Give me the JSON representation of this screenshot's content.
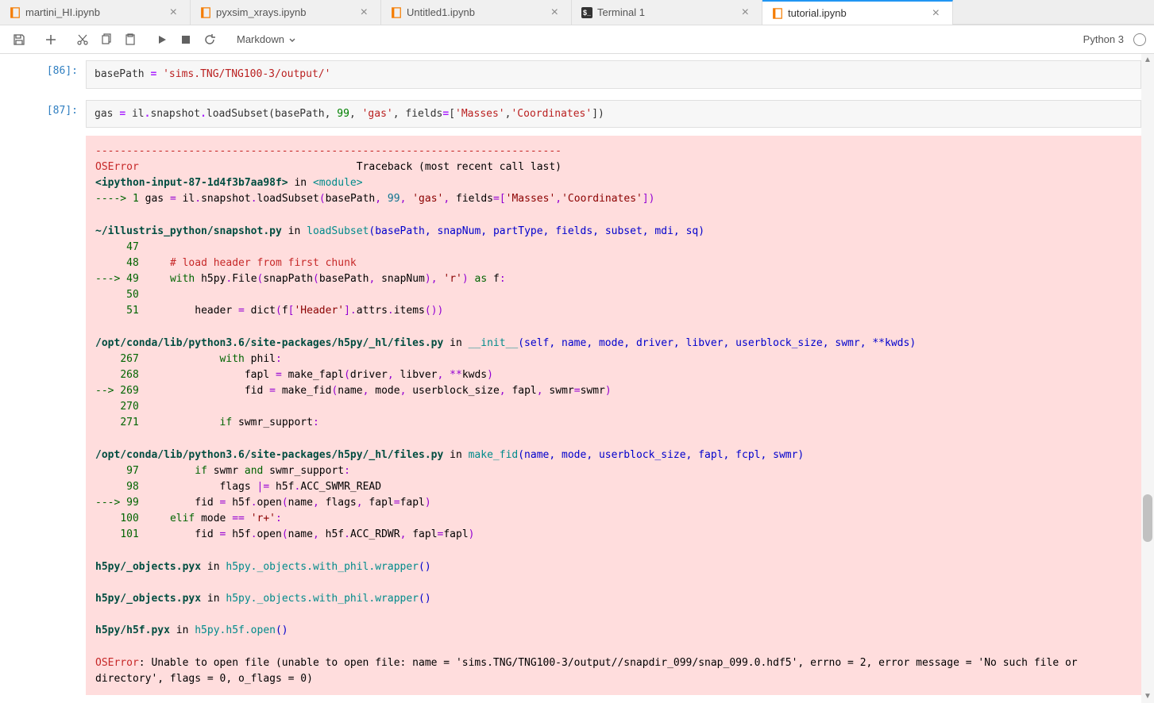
{
  "tabs": [
    {
      "label": "martini_HI.ipynb",
      "type": "notebook",
      "active": false
    },
    {
      "label": "pyxsim_xrays.ipynb",
      "type": "notebook",
      "active": false
    },
    {
      "label": "Untitled1.ipynb",
      "type": "notebook",
      "active": false
    },
    {
      "label": "Terminal 1",
      "type": "terminal",
      "active": false
    },
    {
      "label": "tutorial.ipynb",
      "type": "notebook",
      "active": true
    }
  ],
  "toolbar": {
    "save_title": "Save",
    "add_title": "Insert cell",
    "cut_title": "Cut",
    "copy_title": "Copy",
    "paste_title": "Paste",
    "run_title": "Run",
    "stop_title": "Interrupt",
    "restart_title": "Restart",
    "cell_type": "Markdown"
  },
  "kernel": {
    "name": "Python 3",
    "status": "idle"
  },
  "cells": [
    {
      "prompt": "[86]:",
      "type": "code",
      "source_html": "basePath <span class='s-op'>=</span> <span class='s-str'>'sims.TNG/TNG100-3/output/'</span>"
    },
    {
      "prompt": "[87]:",
      "type": "code",
      "source_html": "gas <span class='s-op'>=</span> il<span class='s-op'>.</span>snapshot<span class='s-op'>.</span>loadSubset(basePath, <span class='s-num'>99</span>, <span class='s-str'>'gas'</span>, fields<span class='s-op'>=</span>[<span class='s-str'>'Masses'</span>,<span class='s-str'>'Coordinates'</span>])"
    }
  ],
  "traceback_lines": [
    {
      "html": "<span class='tb-red'>---------------------------------------------------------------------------</span>"
    },
    {
      "html": "<span class='tb-red'>OSError</span>                                   Traceback (most recent call last)"
    },
    {
      "html": "<span class='tb-darkgreen'>&lt;ipython-input-87-1d4f3b7aa98f&gt;</span> in <span class='tb-cyan'>&lt;module&gt;</span>"
    },
    {
      "html": "<span class='tb-green'>----&gt; 1</span> gas <span class='tb-purple'>=</span> il<span class='tb-purple'>.</span>snapshot<span class='tb-purple'>.</span>loadSubset<span class='tb-purple'>(</span>basePath<span class='tb-purple'>,</span> <span class='tb-cyan-b'>99</span><span class='tb-purple'>,</span> <span class='tb-darkred'>'gas'</span><span class='tb-purple'>,</span> fields<span class='tb-purple'>=[</span><span class='tb-darkred'>'Masses'</span><span class='tb-purple'>,</span><span class='tb-darkred'>'Coordinates'</span><span class='tb-purple'>])</span>"
    },
    {
      "html": ""
    },
    {
      "html": "<span class='tb-darkgreen'>~/illustris_python/snapshot.py</span> in <span class='tb-cyan'>loadSubset</span><span class='tb-blue'>(basePath, snapNum, partType, fields, subset, mdi, sq)</span>"
    },
    {
      "html": "<span class='tb-green'>     47</span> "
    },
    {
      "html": "<span class='tb-green'>     48</span>     <span class='tb-red'># load header from first chunk</span>"
    },
    {
      "html": "<span class='tb-green'>---&gt; 49</span>     <span class='tb-green'>with</span> h5py<span class='tb-purple'>.</span>File<span class='tb-purple'>(</span>snapPath<span class='tb-purple'>(</span>basePath<span class='tb-purple'>,</span> snapNum<span class='tb-purple'>),</span> <span class='tb-darkred'>'r'</span><span class='tb-purple'>)</span> <span class='tb-green'>as</span> f<span class='tb-purple'>:</span>"
    },
    {
      "html": "<span class='tb-green'>     50</span> "
    },
    {
      "html": "<span class='tb-green'>     51</span>         header <span class='tb-purple'>=</span> dict<span class='tb-purple'>(</span>f<span class='tb-purple'>[</span><span class='tb-darkred'>'Header'</span><span class='tb-purple'>].</span>attrs<span class='tb-purple'>.</span>items<span class='tb-purple'>())</span>"
    },
    {
      "html": ""
    },
    {
      "html": "<span class='tb-darkgreen'>/opt/conda/lib/python3.6/site-packages/h5py/_hl/files.py</span> in <span class='tb-cyan'>__init__</span><span class='tb-blue'>(self, name, mode, driver, libver, userblock_size, swmr, **kwds)</span>"
    },
    {
      "html": "<span class='tb-green'>    267</span>             <span class='tb-green'>with</span> phil<span class='tb-purple'>:</span>"
    },
    {
      "html": "<span class='tb-green'>    268</span>                 fapl <span class='tb-purple'>=</span> make_fapl<span class='tb-purple'>(</span>driver<span class='tb-purple'>,</span> libver<span class='tb-purple'>,</span> <span class='tb-purple'>**</span>kwds<span class='tb-purple'>)</span>"
    },
    {
      "html": "<span class='tb-green'>--&gt; 269</span>                 fid <span class='tb-purple'>=</span> make_fid<span class='tb-purple'>(</span>name<span class='tb-purple'>,</span> mode<span class='tb-purple'>,</span> userblock_size<span class='tb-purple'>,</span> fapl<span class='tb-purple'>,</span> swmr<span class='tb-purple'>=</span>swmr<span class='tb-purple'>)</span>"
    },
    {
      "html": "<span class='tb-green'>    270</span> "
    },
    {
      "html": "<span class='tb-green'>    271</span>             <span class='tb-green'>if</span> swmr_support<span class='tb-purple'>:</span>"
    },
    {
      "html": ""
    },
    {
      "html": "<span class='tb-darkgreen'>/opt/conda/lib/python3.6/site-packages/h5py/_hl/files.py</span> in <span class='tb-cyan'>make_fid</span><span class='tb-blue'>(name, mode, userblock_size, fapl, fcpl, swmr)</span>"
    },
    {
      "html": "<span class='tb-green'>     97</span>         <span class='tb-green'>if</span> swmr <span class='tb-green'>and</span> swmr_support<span class='tb-purple'>:</span>"
    },
    {
      "html": "<span class='tb-green'>     98</span>             flags <span class='tb-purple'>|=</span> h5f<span class='tb-purple'>.</span>ACC_SWMR_READ"
    },
    {
      "html": "<span class='tb-green'>---&gt; 99</span>         fid <span class='tb-purple'>=</span> h5f<span class='tb-purple'>.</span>open<span class='tb-purple'>(</span>name<span class='tb-purple'>,</span> flags<span class='tb-purple'>,</span> fapl<span class='tb-purple'>=</span>fapl<span class='tb-purple'>)</span>"
    },
    {
      "html": "<span class='tb-green'>    100</span>     <span class='tb-green'>elif</span> mode <span class='tb-purple'>==</span> <span class='tb-darkred'>'r+'</span><span class='tb-purple'>:</span>"
    },
    {
      "html": "<span class='tb-green'>    101</span>         fid <span class='tb-purple'>=</span> h5f<span class='tb-purple'>.</span>open<span class='tb-purple'>(</span>name<span class='tb-purple'>,</span> h5f<span class='tb-purple'>.</span>ACC_RDWR<span class='tb-purple'>,</span> fapl<span class='tb-purple'>=</span>fapl<span class='tb-purple'>)</span>"
    },
    {
      "html": ""
    },
    {
      "html": "<span class='tb-darkgreen'>h5py/_objects.pyx</span> in <span class='tb-cyan'>h5py._objects.with_phil.wrapper</span><span class='tb-blue'>()</span>"
    },
    {
      "html": ""
    },
    {
      "html": "<span class='tb-darkgreen'>h5py/_objects.pyx</span> in <span class='tb-cyan'>h5py._objects.with_phil.wrapper</span><span class='tb-blue'>()</span>"
    },
    {
      "html": ""
    },
    {
      "html": "<span class='tb-darkgreen'>h5py/h5f.pyx</span> in <span class='tb-cyan'>h5py.h5f.open</span><span class='tb-blue'>()</span>"
    },
    {
      "html": ""
    },
    {
      "html": "<span class='tb-red'>OSError</span>: Unable to open file (unable to open file: name = 'sims.TNG/TNG100-3/output//snapdir_099/snap_099.0.hdf5', errno = 2, error message = 'No such file or directory', flags = 0, o_flags = 0)"
    }
  ]
}
